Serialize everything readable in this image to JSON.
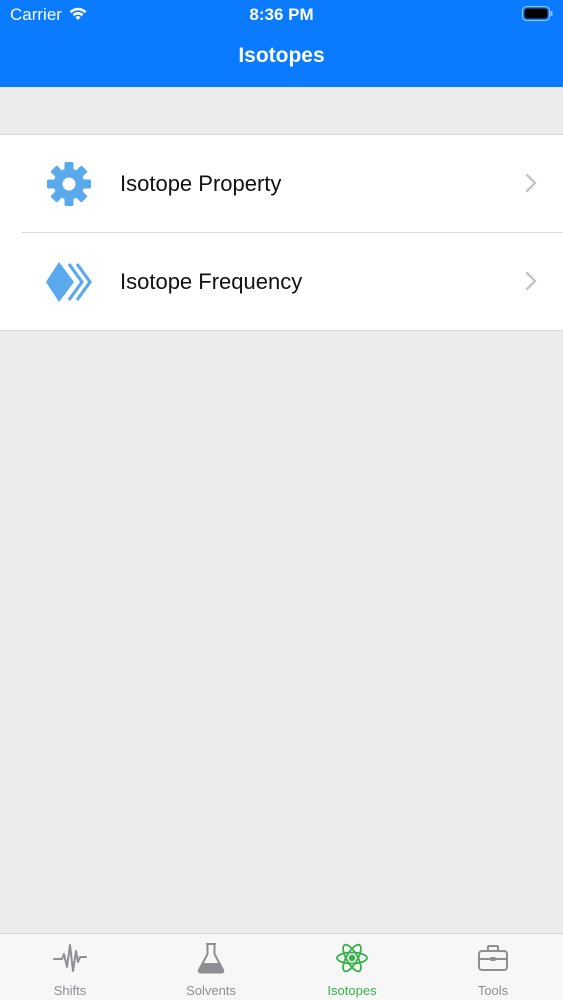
{
  "status_bar": {
    "carrier": "Carrier",
    "time": "8:36 PM",
    "wifi_icon": "wifi-icon",
    "battery_icon": "battery-icon"
  },
  "nav": {
    "title": "Isotopes",
    "bar_color": "#0a7aff"
  },
  "list": {
    "items": [
      {
        "label": "Isotope Property",
        "icon": "gear-icon",
        "icon_color": "#5aa9ec"
      },
      {
        "label": "Isotope Frequency",
        "icon": "frequency-icon",
        "icon_color": "#5aa9ec"
      }
    ]
  },
  "tabbar": {
    "active_color": "#35b34a",
    "inactive_color": "#8e8e93",
    "tabs": [
      {
        "label": "Shifts",
        "icon": "waveform-icon",
        "active": false
      },
      {
        "label": "Solvents",
        "icon": "flask-icon",
        "active": false
      },
      {
        "label": "Isotopes",
        "icon": "atom-icon",
        "active": true
      },
      {
        "label": "Tools",
        "icon": "toolbox-icon",
        "active": false
      }
    ]
  }
}
